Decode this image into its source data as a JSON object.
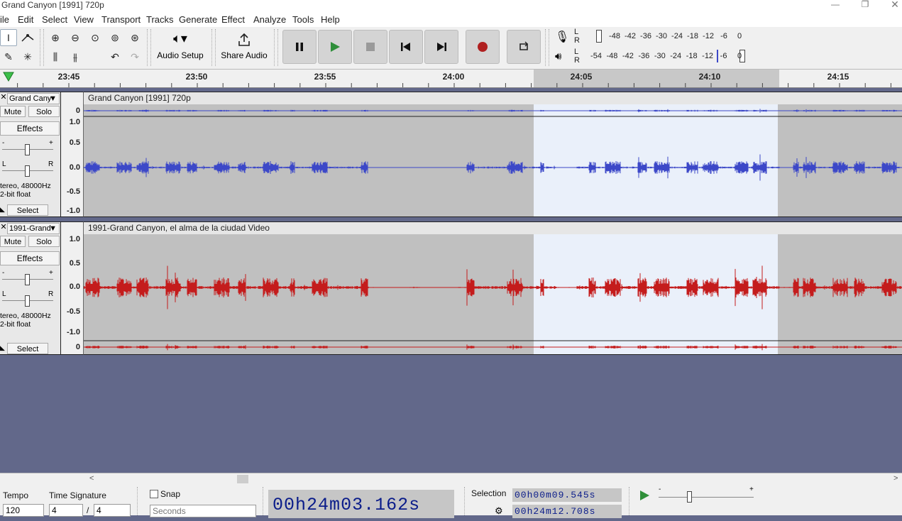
{
  "window": {
    "title": "Grand Canyon [1991] 720p"
  },
  "menus": [
    "ile",
    "Edit",
    "Select",
    "View",
    "Transport",
    "Tracks",
    "Generate",
    "Effect",
    "Analyze",
    "Tools",
    "Help"
  ],
  "toolbar": {
    "audio_setup": "Audio Setup",
    "share_audio": "Share Audio"
  },
  "meters": {
    "record": {
      "l": "L",
      "r": "R",
      "scale": [
        "-48",
        "-42",
        "-36",
        "-30",
        "-24",
        "-18",
        "-12",
        "-6",
        "0"
      ]
    },
    "play": {
      "l": "L",
      "r": "R",
      "scale": [
        "-54",
        "-48",
        "-42",
        "-36",
        "-30",
        "-24",
        "-18",
        "-12",
        "-6",
        "0"
      ]
    }
  },
  "ruler": {
    "ticks": [
      "23:45",
      "23:50",
      "23:55",
      "24:00",
      "24:05",
      "24:10",
      "24:15"
    ]
  },
  "tracks": [
    {
      "name": "Grand Cany",
      "clip": "Grand Canyon [1991] 720p",
      "mute": "Mute",
      "solo": "Solo",
      "effects": "Effects",
      "gain_l": "-",
      "gain_r": "+",
      "pan_l": "L",
      "pan_r": "R",
      "info1": "tereo, 48000Hz",
      "info2": "2-bit float",
      "select": "Select",
      "scale": [
        "1.0",
        "0.5",
        "0.0",
        "-0.5",
        "-1.0"
      ],
      "zero": "0",
      "color": "#3c48c8"
    },
    {
      "name": "1991-Grand",
      "clip": "1991-Grand Canyon, el alma de la ciudad Video",
      "mute": "Mute",
      "solo": "Solo",
      "effects": "Effects",
      "gain_l": "-",
      "gain_r": "+",
      "pan_l": "L",
      "pan_r": "R",
      "info1": "tereo, 48000Hz",
      "info2": "2-bit float",
      "select": "Select",
      "scale": [
        "1.0",
        "0.5",
        "0.0",
        "-0.5",
        "-1.0"
      ],
      "zero": "0",
      "color": "#c41c1c"
    }
  ],
  "bottom": {
    "tempo_label": "Tempo",
    "tempo": "120",
    "timesig_label": "Time Signature",
    "timesig_num": "4",
    "timesig_sep": "/",
    "timesig_den": "4",
    "snap_label": "Snap",
    "snap_unit": "Seconds",
    "time": {
      "h": "00",
      "hu": "h",
      "m": "24",
      "mu": "m",
      "s": "03.162",
      "su": "s"
    },
    "selection_label": "Selection",
    "sel_start": "00h00m09.545s",
    "sel_end": "00h24m12.708s"
  }
}
